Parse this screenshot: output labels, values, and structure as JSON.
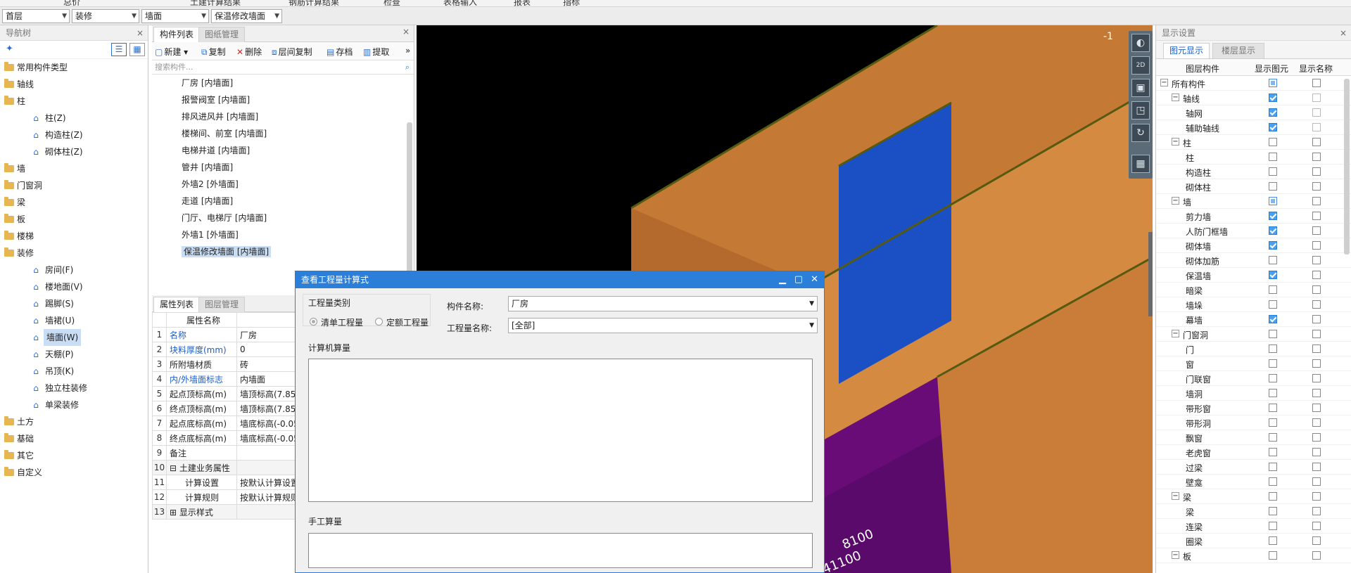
{
  "top_menu": [
    "总价",
    "土建计算结果",
    "钢筋计算结果",
    "检查",
    "表格输入",
    "报表",
    "指标"
  ],
  "filters": {
    "floor": "首层",
    "category": "装修",
    "type": "墙面",
    "component": "保温修改墙面"
  },
  "nav": {
    "title": "导航树",
    "items": [
      {
        "label": "常用构件类型",
        "level": 0
      },
      {
        "label": "轴线",
        "level": 0
      },
      {
        "label": "柱",
        "level": 0
      },
      {
        "label": "柱(Z)",
        "level": 1,
        "icon": "column-icon"
      },
      {
        "label": "构造柱(Z)",
        "level": 1,
        "icon": "constructional-column-icon"
      },
      {
        "label": "砌体柱(Z)",
        "level": 1,
        "icon": "masonry-column-icon"
      },
      {
        "label": "墙",
        "level": 0
      },
      {
        "label": "门窗洞",
        "level": 0
      },
      {
        "label": "梁",
        "level": 0
      },
      {
        "label": "板",
        "level": 0
      },
      {
        "label": "楼梯",
        "level": 0
      },
      {
        "label": "装修",
        "level": 0
      },
      {
        "label": "房间(F)",
        "level": 1,
        "icon": "room-icon"
      },
      {
        "label": "楼地面(V)",
        "level": 1,
        "icon": "floor-icon"
      },
      {
        "label": "踢脚(S)",
        "level": 1,
        "icon": "skirting-icon"
      },
      {
        "label": "墙裙(U)",
        "level": 1,
        "icon": "dado-icon"
      },
      {
        "label": "墙面(W)",
        "level": 1,
        "icon": "wall-surface-icon",
        "selected": true
      },
      {
        "label": "天棚(P)",
        "level": 1,
        "icon": "ceiling-icon"
      },
      {
        "label": "吊顶(K)",
        "level": 1,
        "icon": "suspended-ceiling-icon"
      },
      {
        "label": "独立柱装修",
        "level": 1,
        "icon": "column-decoration-icon"
      },
      {
        "label": "单梁装修",
        "level": 1,
        "icon": "beam-decoration-icon"
      },
      {
        "label": "土方",
        "level": 0
      },
      {
        "label": "基础",
        "level": 0
      },
      {
        "label": "其它",
        "level": 0
      },
      {
        "label": "自定义",
        "level": 0
      }
    ]
  },
  "components": {
    "tabs": [
      "构件列表",
      "图纸管理"
    ],
    "toolbar": [
      "新建",
      "复制",
      "删除",
      "层间复制",
      "存档",
      "提取"
    ],
    "search_placeholder": "搜索构件...",
    "items": [
      "厂房 [内墙面]",
      "报警阀室 [内墙面]",
      "排风进风井 [内墙面]",
      "楼梯间、前室 [内墙面]",
      "电梯井道 [内墙面]",
      "管井 [内墙面]",
      "外墙2 [外墙面]",
      "走道 [内墙面]",
      "门厅、电梯厅 [内墙面]",
      "外墙1 [外墙面]",
      "保温修改墙面 [内墙面]"
    ],
    "selected_index": 10
  },
  "properties": {
    "tabs": [
      "属性列表",
      "图层管理"
    ],
    "header": "属性名称",
    "rows": [
      {
        "n": "1",
        "k": "名称",
        "v": "厂房",
        "blue": true
      },
      {
        "n": "2",
        "k": "块料厚度(mm)",
        "v": "0",
        "blue": true
      },
      {
        "n": "3",
        "k": "所附墙材质",
        "v": "砖"
      },
      {
        "n": "4",
        "k": "内/外墙面标志",
        "v": "内墙面",
        "blue": true
      },
      {
        "n": "5",
        "k": "起点顶标高(m)",
        "v": "墙顶标高(7.85"
      },
      {
        "n": "6",
        "k": "终点顶标高(m)",
        "v": "墙顶标高(7.85"
      },
      {
        "n": "7",
        "k": "起点底标高(m)",
        "v": "墙底标高(-0.05"
      },
      {
        "n": "8",
        "k": "终点底标高(m)",
        "v": "墙底标高(-0.05"
      },
      {
        "n": "9",
        "k": "备注",
        "v": ""
      },
      {
        "n": "10",
        "k": "土建业务属性",
        "v": "",
        "group": "−"
      },
      {
        "n": "11",
        "k": "计算设置",
        "v": "按默认计算设置",
        "child": true
      },
      {
        "n": "12",
        "k": "计算规则",
        "v": "按默认计算规则",
        "child": true
      },
      {
        "n": "13",
        "k": "显示样式",
        "v": "",
        "group": "+"
      }
    ]
  },
  "viewport": {
    "labels": [
      "8100",
      "41100",
      "-1"
    ]
  },
  "display": {
    "title": "显示设置",
    "tabs": [
      "图元显示",
      "楼层显示"
    ],
    "columns": [
      "图层构件",
      "显示图元",
      "显示名称"
    ],
    "rows": [
      {
        "label": "所有构件",
        "level": 0,
        "tog": "−",
        "a": "part",
        "b": "off"
      },
      {
        "label": "轴线",
        "level": 1,
        "tog": "−",
        "a": "on",
        "b": "dis"
      },
      {
        "label": "轴网",
        "level": 2,
        "a": "on",
        "b": "dis"
      },
      {
        "label": "辅助轴线",
        "level": 2,
        "a": "on",
        "b": "dis"
      },
      {
        "label": "柱",
        "level": 1,
        "tog": "−",
        "a": "off",
        "b": "off"
      },
      {
        "label": "柱",
        "level": 2,
        "a": "off",
        "b": "off"
      },
      {
        "label": "构造柱",
        "level": 2,
        "a": "off",
        "b": "off"
      },
      {
        "label": "砌体柱",
        "level": 2,
        "a": "off",
        "b": "off"
      },
      {
        "label": "墙",
        "level": 1,
        "tog": "−",
        "a": "part",
        "b": "off"
      },
      {
        "label": "剪力墙",
        "level": 2,
        "a": "on",
        "b": "off"
      },
      {
        "label": "人防门框墙",
        "level": 2,
        "a": "on",
        "b": "off"
      },
      {
        "label": "砌体墙",
        "level": 2,
        "a": "on",
        "b": "off"
      },
      {
        "label": "砌体加筋",
        "level": 2,
        "a": "off",
        "b": "off"
      },
      {
        "label": "保温墙",
        "level": 2,
        "a": "on",
        "b": "off"
      },
      {
        "label": "暗梁",
        "level": 2,
        "a": "off",
        "b": "off"
      },
      {
        "label": "墙垛",
        "level": 2,
        "a": "off",
        "b": "off"
      },
      {
        "label": "幕墙",
        "level": 2,
        "a": "on",
        "b": "off"
      },
      {
        "label": "门窗洞",
        "level": 1,
        "tog": "−",
        "a": "off",
        "b": "off"
      },
      {
        "label": "门",
        "level": 2,
        "a": "off",
        "b": "off"
      },
      {
        "label": "窗",
        "level": 2,
        "a": "off",
        "b": "off"
      },
      {
        "label": "门联窗",
        "level": 2,
        "a": "off",
        "b": "off"
      },
      {
        "label": "墙洞",
        "level": 2,
        "a": "off",
        "b": "off"
      },
      {
        "label": "带形窗",
        "level": 2,
        "a": "off",
        "b": "off"
      },
      {
        "label": "带形洞",
        "level": 2,
        "a": "off",
        "b": "off"
      },
      {
        "label": "飘窗",
        "level": 2,
        "a": "off",
        "b": "off"
      },
      {
        "label": "老虎窗",
        "level": 2,
        "a": "off",
        "b": "off"
      },
      {
        "label": "过梁",
        "level": 2,
        "a": "off",
        "b": "off"
      },
      {
        "label": "壁龛",
        "level": 2,
        "a": "off",
        "b": "off"
      },
      {
        "label": "梁",
        "level": 1,
        "tog": "−",
        "a": "off",
        "b": "off"
      },
      {
        "label": "梁",
        "level": 2,
        "a": "off",
        "b": "off"
      },
      {
        "label": "连梁",
        "level": 2,
        "a": "off",
        "b": "off"
      },
      {
        "label": "圈梁",
        "level": 2,
        "a": "off",
        "b": "off"
      },
      {
        "label": "板",
        "level": 1,
        "tog": "−",
        "a": "off",
        "b": "off"
      }
    ]
  },
  "dialog": {
    "title": "查看工程量计算式",
    "quantity_type_label": "工程量类别",
    "radio_bill": "清单工程量",
    "radio_quota": "定额工程量",
    "component_name_label": "构件名称:",
    "component_name_value": "厂房",
    "quantity_name_label": "工程量名称:",
    "quantity_name_value": "[全部]",
    "computer_label": "计算机算量",
    "manual_label": "手工算量"
  }
}
